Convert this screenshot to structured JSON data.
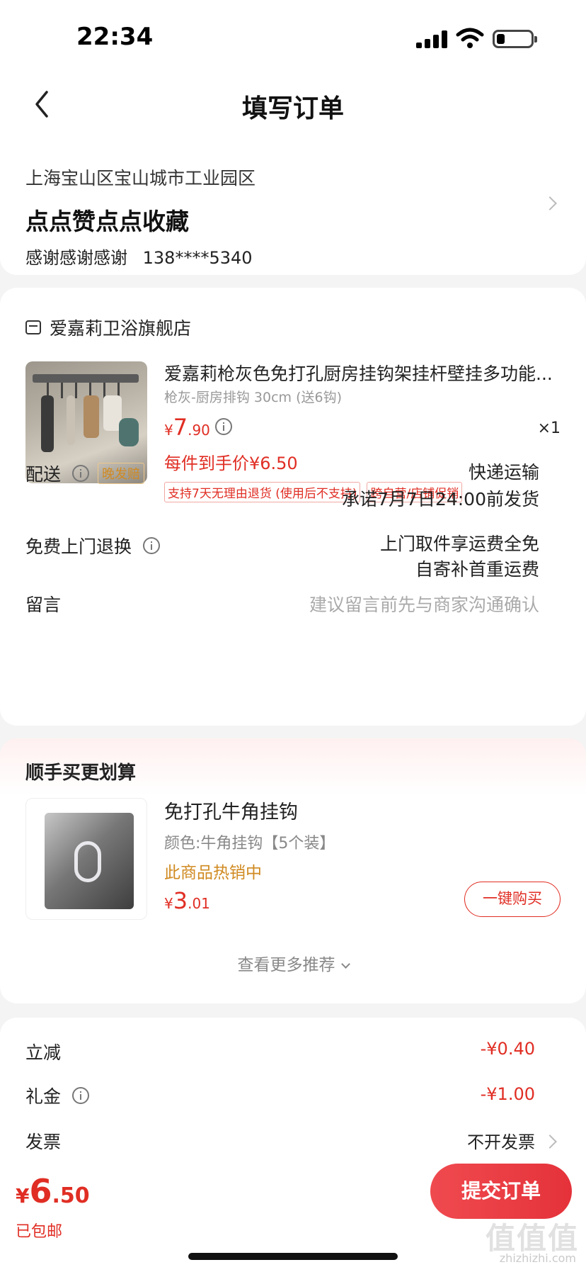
{
  "status_bar": {
    "time": "22:34"
  },
  "nav": {
    "title": "填写订单"
  },
  "address": {
    "region": "上海宝山区宝山城市工业园区",
    "name": "点点赞点点收藏",
    "receiver": "感谢感谢感谢",
    "phone": "138****5340"
  },
  "order": {
    "shop_name": "爱嘉莉卫浴旗舰店",
    "product": {
      "title": "爱嘉莉枪灰色免打孔厨房挂钩架挂杆壁挂多功能...",
      "spec": "枪灰-厨房排钩 30cm (送6钩)",
      "price_symbol": "¥",
      "price_int": "7",
      "price_dec": ".90",
      "quantity": "×1",
      "final_price": "每件到手价¥6.50",
      "tags": [
        "支持7天无理由退货 (使用后不支持)",
        "跨自营/店铺促销"
      ]
    },
    "delivery": {
      "label": "配送",
      "badge": "晚发赔",
      "method": "快递运输",
      "promise": "承诺7月7日24:00前发货"
    },
    "return_service": {
      "label": "免费上门退换",
      "line1": "上门取件享运费全免",
      "line2": "自寄补首重运费"
    },
    "message": {
      "label": "留言",
      "placeholder": "建议留言前先与商家沟通确认"
    }
  },
  "recommend": {
    "title": "顺手买更划算",
    "item": {
      "name": "免打孔牛角挂钩",
      "spec": "颜色:牛角挂钩【5个装】",
      "hot": "此商品热销中",
      "price_symbol": "¥",
      "price_int": "3",
      "price_dec": ".01",
      "buy_label": "一键购买"
    },
    "more_label": "查看更多推荐"
  },
  "fees": {
    "discount_label": "立减",
    "discount_value": "-¥0.40",
    "gift_label": "礼金",
    "gift_value": "-¥1.00",
    "invoice_label": "发票",
    "invoice_value": "不开发票"
  },
  "bottom": {
    "price_symbol": "¥",
    "price_int": "6",
    "price_dec": ".50",
    "shipping": "已包邮",
    "submit_label": "提交订单"
  },
  "watermark": {
    "main": "值值值",
    "sub": "zhizhizhi.com"
  },
  "colors": {
    "accent": "#e02e24",
    "orange": "#d08a21",
    "background": "#f4f4f4"
  }
}
